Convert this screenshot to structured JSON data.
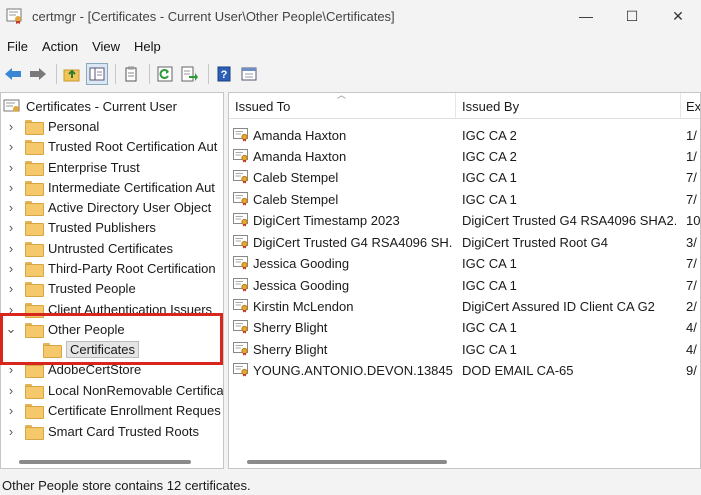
{
  "window": {
    "title": "certmgr - [Certificates - Current User\\Other People\\Certificates]",
    "minimize_glyph": "—",
    "maximize_glyph": "☐",
    "close_glyph": "✕"
  },
  "menu": [
    "File",
    "Action",
    "View",
    "Help"
  ],
  "toolbar": {
    "icons": [
      "back-arrow-icon",
      "forward-arrow-icon",
      "up-folder-icon",
      "show-hide-tree-icon",
      "copy-icon",
      "refresh-icon",
      "export-list-icon",
      "help-icon",
      "properties-icon"
    ]
  },
  "tree": {
    "root": "Certificates - Current User",
    "items": [
      "Personal",
      "Trusted Root Certification Aut",
      "Enterprise Trust",
      "Intermediate Certification Aut",
      "Active Directory User Object",
      "Trusted Publishers",
      "Untrusted Certificates",
      "Third-Party Root Certification",
      "Trusted People",
      "Client Authentication Issuers",
      "Other People",
      "Certificates",
      "AdobeCertStore",
      "Local NonRemovable Certifica",
      "Certificate Enrollment Reques",
      "Smart Card Trusted Roots"
    ]
  },
  "list": {
    "columns": [
      "Issued To",
      "Issued By",
      "Ex"
    ],
    "rows": [
      {
        "issued_to": "Amanda Haxton",
        "issued_by": "IGC CA 2",
        "ex": "1/"
      },
      {
        "issued_to": "Amanda Haxton",
        "issued_by": "IGC CA 2",
        "ex": "1/"
      },
      {
        "issued_to": "Caleb Stempel",
        "issued_by": "IGC CA 1",
        "ex": "7/"
      },
      {
        "issued_to": "Caleb Stempel",
        "issued_by": "IGC CA 1",
        "ex": "7/"
      },
      {
        "issued_to": "DigiCert Timestamp 2023",
        "issued_by": "DigiCert Trusted G4 RSA4096 SHA2...",
        "ex": "10"
      },
      {
        "issued_to": "DigiCert Trusted G4 RSA4096 SH...",
        "issued_by": "DigiCert Trusted Root G4",
        "ex": "3/"
      },
      {
        "issued_to": "Jessica Gooding",
        "issued_by": "IGC CA 1",
        "ex": "7/"
      },
      {
        "issued_to": "Jessica Gooding",
        "issued_by": "IGC CA 1",
        "ex": "7/"
      },
      {
        "issued_to": "Kirstin McLendon",
        "issued_by": "DigiCert Assured ID Client CA G2",
        "ex": "2/"
      },
      {
        "issued_to": "Sherry Blight",
        "issued_by": "IGC CA 1",
        "ex": "4/"
      },
      {
        "issued_to": "Sherry Blight",
        "issued_by": "IGC CA 1",
        "ex": "4/"
      },
      {
        "issued_to": "YOUNG.ANTONIO.DEVON.13845...",
        "issued_by": "DOD EMAIL CA-65",
        "ex": "9/"
      }
    ]
  },
  "status": "Other People store contains 12 certificates.",
  "colors": {
    "highlight": "#d9261c",
    "folder": "#f5c96b"
  }
}
